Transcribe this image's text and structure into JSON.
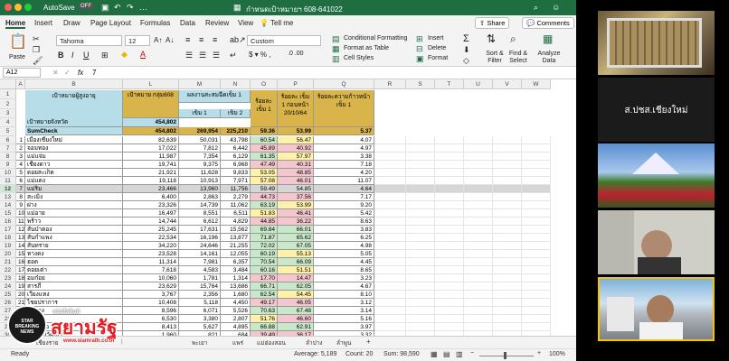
{
  "window": {
    "autosave": "AutoSave",
    "autosave_state": "OFF",
    "title": "กำหนดเป้าหมายฯ 608-641022"
  },
  "menu_tabs": [
    "Home",
    "Insert",
    "Draw",
    "Page Layout",
    "Formulas",
    "Data",
    "Review",
    "View"
  ],
  "tell_me": "Tell me",
  "share": "Share",
  "comments": "Comments",
  "ribbon": {
    "paste": "Paste",
    "font": "Tahoma",
    "size": "12",
    "number_format": "Custom",
    "cond_fmt": "Conditional Formatting",
    "fmt_table": "Format as Table",
    "cell_styles": "Cell Styles",
    "insert": "Insert",
    "delete": "Delete",
    "format": "Format",
    "sort_filter": "Sort & Filter",
    "find_select": "Find & Select",
    "analyze": "Analyze Data"
  },
  "formula_bar": {
    "name_box": "A12",
    "fx": "fx",
    "value": "7"
  },
  "columns": [
    "A",
    "B",
    "L",
    "M",
    "N",
    "O",
    "P",
    "Q",
    "R",
    "S",
    "T",
    "U",
    "V",
    "W"
  ],
  "headers": {
    "b": "เป้าหมายผู้สูงอายุ",
    "l": "เป้าหมาย กลุ่ม608",
    "m": "ผลงานสะสมฉีดเข็ม 1",
    "m2": "เข็ม 1",
    "n2": "เข็ม 2",
    "p": "ร้อยละ เข็ม 1",
    "q": "ร้อยละ เข็ม 1 ก่อนหน้า 20/10/64",
    "s": "ร้อยละความก้าวหน้า เข็ม 1"
  },
  "target_row": {
    "label": "เป้าหมายจังหวัด",
    "value": "454,802"
  },
  "sum_row": {
    "label": "SumCheck",
    "l": "454,802",
    "m": "269,954",
    "n": "225,210",
    "p": "59.36",
    "q": "53.99",
    "s": "5.37"
  },
  "rows": [
    [
      "1",
      "เมืองเชียงใหม่",
      "82,639",
      "50,031",
      "43,798",
      "60.54",
      "56.47",
      "4.07"
    ],
    [
      "2",
      "จอมทอง",
      "17,022",
      "7,812",
      "6,442",
      "45.89",
      "40.92",
      "4.97"
    ],
    [
      "3",
      "แม่แจ่ม",
      "11,987",
      "7,354",
      "6,129",
      "61.35",
      "57.97",
      "3.38"
    ],
    [
      "4",
      "เชียงดาว",
      "19,741",
      "9,375",
      "6,968",
      "47.49",
      "40.31",
      "7.18"
    ],
    [
      "5",
      "ดอยสะเก็ด",
      "21,921",
      "11,628",
      "9,833",
      "53.05",
      "48.85",
      "4.20"
    ],
    [
      "6",
      "แม่แตง",
      "19,118",
      "10,913",
      "7,971",
      "57.08",
      "46.01",
      "11.07"
    ],
    [
      "7",
      "แม่ริม",
      "23,466",
      "13,960",
      "11,756",
      "59.49",
      "54.85",
      "4.64"
    ],
    [
      "8",
      "สะเมิง",
      "6,400",
      "2,863",
      "2,279",
      "44.73",
      "37.56",
      "7.17"
    ],
    [
      "9",
      "ฝาง",
      "23,326",
      "14,739",
      "11,062",
      "63.19",
      "53.99",
      "9.20"
    ],
    [
      "10",
      "แม่อาย",
      "16,497",
      "8,551",
      "6,511",
      "51.83",
      "46.41",
      "5.42"
    ],
    [
      "11",
      "พร้าว",
      "14,744",
      "6,612",
      "4,829",
      "44.85",
      "36.22",
      "8.63"
    ],
    [
      "12",
      "สันป่าตอง",
      "25,245",
      "17,631",
      "15,562",
      "69.84",
      "66.01",
      "3.83"
    ],
    [
      "13",
      "สันกำแพง",
      "22,534",
      "16,196",
      "13,877",
      "71.87",
      "65.62",
      "6.25"
    ],
    [
      "14",
      "สันทราย",
      "34,220",
      "24,646",
      "21,255",
      "72.02",
      "67.05",
      "4.98"
    ],
    [
      "15",
      "หางดง",
      "23,528",
      "14,161",
      "12,055",
      "60.19",
      "55.13",
      "5.05"
    ],
    [
      "16",
      "ฮอด",
      "11,314",
      "7,981",
      "6,357",
      "70.54",
      "66.09",
      "4.45"
    ],
    [
      "17",
      "ดอยเต่า",
      "7,618",
      "4,583",
      "3,484",
      "60.16",
      "51.51",
      "8.65"
    ],
    [
      "18",
      "อมก๋อย",
      "10,060",
      "1,781",
      "1,314",
      "17.70",
      "14.47",
      "3.23"
    ],
    [
      "19",
      "สารภี",
      "23,629",
      "15,764",
      "13,686",
      "66.71",
      "62.05",
      "4.67"
    ],
    [
      "20",
      "เวียงแหง",
      "3,767",
      "2,356",
      "1,680",
      "62.54",
      "54.45",
      "8.10"
    ],
    [
      "21",
      "ไชยปราการ",
      "10,408",
      "5,118",
      "4,450",
      "49.17",
      "46.05",
      "3.12"
    ],
    [
      "22",
      "แม่วาง",
      "8,596",
      "6,071",
      "5,526",
      "70.63",
      "67.48",
      "3.14"
    ],
    [
      "23",
      "แม่ออน",
      "6,530",
      "3,380",
      "2,807",
      "51.76",
      "46.60",
      "5.16"
    ],
    [
      "24",
      "ดอยหล่อ",
      "8,413",
      "5,627",
      "4,895",
      "66.88",
      "62.91",
      "3.97"
    ],
    [
      "25",
      "กัลยาณิวัฒนา",
      "1,960",
      "821",
      "684",
      "39.49",
      "36.17",
      "3.32"
    ]
  ],
  "sheet_tabs": [
    "เชียงราย",
    "พะเยา",
    "แพร่",
    "แม่ฮ่องสอน",
    "ลำปาง",
    "ลำพูน"
  ],
  "status": {
    "ready": "Ready",
    "average": "Average: 5,189",
    "count": "Count: 20",
    "sum": "Sum: 98,590",
    "zoom": "100%"
  },
  "watermark": {
    "brand": "สยามรัฐ",
    "sub": "หนังสือพิมพ์",
    "url": "www.siamrath.co.th",
    "badge": "STAR BREAKING NEWS"
  },
  "gallery": {
    "speaker_name": "ส.ปชส.เชียงใหม่"
  },
  "colors": {
    "excel_green": "#1e6e42",
    "header_blue": "#b7dde8",
    "header_gold": "#d9b44a",
    "selected_row": "#d6d6d6",
    "pink": "#f4c7ce",
    "yellow": "#fff2a8",
    "green": "#c9e8c9"
  }
}
